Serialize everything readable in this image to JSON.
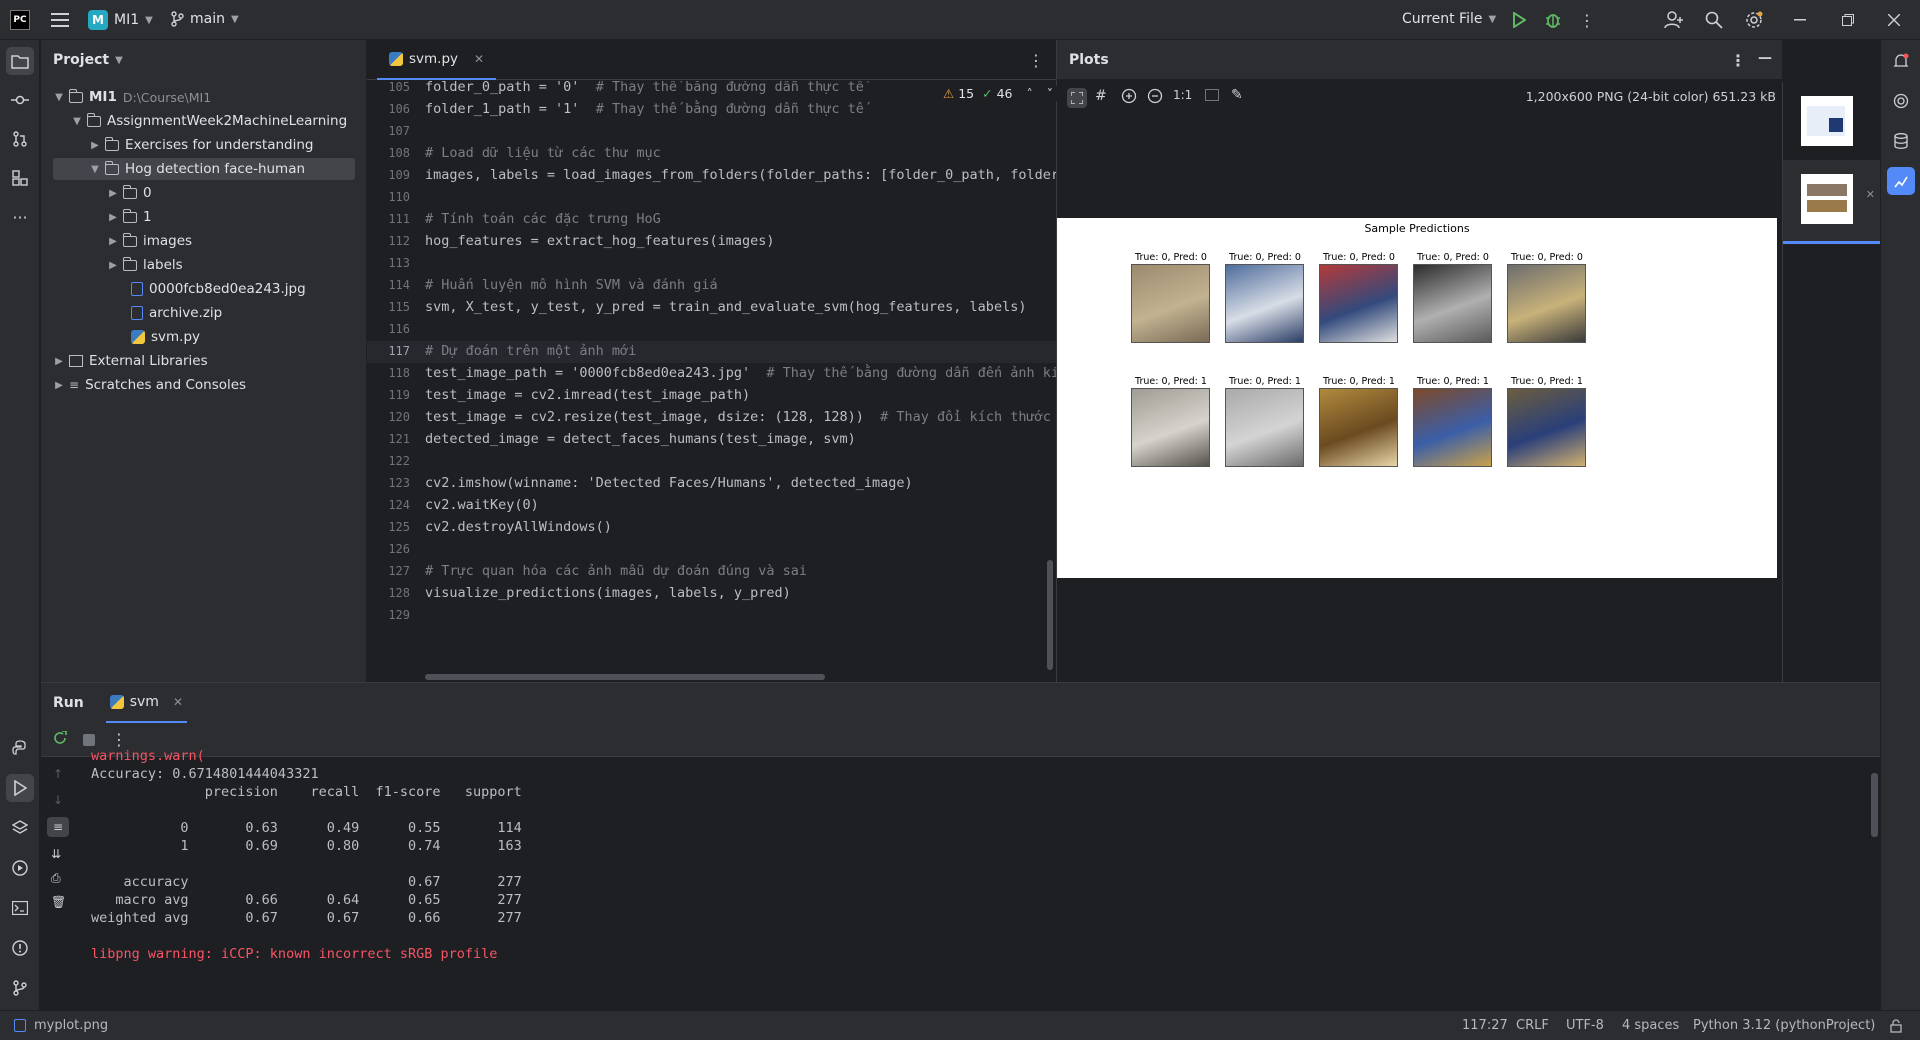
{
  "titlebar": {
    "app_logo": "PC",
    "project_badge": "M",
    "project_name": "MI1",
    "branch": "main",
    "run_config": "Current File"
  },
  "project_panel": {
    "title": "Project",
    "tree": [
      {
        "label": "MI1",
        "hint": "D:\\Course\\MI1",
        "type": "folder",
        "expanded": true
      },
      {
        "label": "AssignmentWeek2MachineLearning",
        "type": "folder",
        "expanded": true
      },
      {
        "label": "Exercises for understanding",
        "type": "folder",
        "expanded": false
      },
      {
        "label": "Hog detection face-human",
        "type": "folder",
        "expanded": true,
        "selected": true
      },
      {
        "label": "0",
        "type": "folder"
      },
      {
        "label": "1",
        "type": "folder"
      },
      {
        "label": "images",
        "type": "folder"
      },
      {
        "label": "labels",
        "type": "folder"
      },
      {
        "label": "0000fcb8ed0ea243.jpg",
        "type": "image"
      },
      {
        "label": "archive.zip",
        "type": "archive"
      },
      {
        "label": "svm.py",
        "type": "python"
      },
      {
        "label": "External Libraries",
        "type": "library"
      },
      {
        "label": "Scratches and Consoles",
        "type": "scratch"
      }
    ]
  },
  "editor": {
    "tab": "svm.py",
    "inspections": {
      "warnings": "15",
      "ok": "46"
    },
    "current_line": "117",
    "lines": [
      {
        "n": "105",
        "text": "folder_0_path = '0'  # Thay thế bằng đường dẫn thực tế"
      },
      {
        "n": "106",
        "text": "folder_1_path = '1'  # Thay thế bằng đường dẫn thực tế"
      },
      {
        "n": "107",
        "text": ""
      },
      {
        "n": "108",
        "text": "# Load dữ liệu từ các thư mục"
      },
      {
        "n": "109",
        "text": "images, labels = load_images_from_folders(folder_paths: [folder_0_path, folder_1_p"
      },
      {
        "n": "110",
        "text": ""
      },
      {
        "n": "111",
        "text": "# Tính toán các đặc trưng HoG"
      },
      {
        "n": "112",
        "text": "hog_features = extract_hog_features(images)"
      },
      {
        "n": "113",
        "text": ""
      },
      {
        "n": "114",
        "text": "# Huấn luyện mô hình SVM và đánh giá"
      },
      {
        "n": "115",
        "text": "svm, X_test, y_test, y_pred = train_and_evaluate_svm(hog_features, labels)"
      },
      {
        "n": "116",
        "text": ""
      },
      {
        "n": "117",
        "text": "# Dự đoán trên một ảnh mới"
      },
      {
        "n": "118",
        "text": "test_image_path = '0000fcb8ed0ea243.jpg'  # Thay thế bằng đường dẫn đến ảnh kiể"
      },
      {
        "n": "119",
        "text": "test_image = cv2.imread(test_image_path)"
      },
      {
        "n": "120",
        "text": "test_image = cv2.resize(test_image, dsize: (128, 128))  # Thay đổi kích thước ản"
      },
      {
        "n": "121",
        "text": "detected_image = detect_faces_humans(test_image, svm)"
      },
      {
        "n": "122",
        "text": ""
      },
      {
        "n": "123",
        "text": "cv2.imshow(winname: 'Detected Faces/Humans', detected_image)"
      },
      {
        "n": "124",
        "text": "cv2.waitKey(0)"
      },
      {
        "n": "125",
        "text": "cv2.destroyAllWindows()"
      },
      {
        "n": "126",
        "text": ""
      },
      {
        "n": "127",
        "text": "# Trực quan hóa các ảnh mẫu dự đoán đúng và sai"
      },
      {
        "n": "128",
        "text": "visualize_predictions(images, labels, y_pred)"
      },
      {
        "n": "129",
        "text": ""
      }
    ]
  },
  "plots": {
    "title": "Plots",
    "zoom_label": "1:1",
    "image_info": "1,200x600 PNG (24-bit color) 651.23 kB",
    "figure_title": "Sample Predictions",
    "row1_titles": [
      "True: 0, Pred: 0",
      "True: 0, Pred: 0",
      "True: 0, Pred: 0",
      "True: 0, Pred: 0",
      "True: 0, Pred: 0"
    ],
    "row2_titles": [
      "True: 0, Pred: 1",
      "True: 0, Pred: 1",
      "True: 0, Pred: 1",
      "True: 0, Pred: 1",
      "True: 0, Pred: 1"
    ]
  },
  "run_panel": {
    "title": "Run",
    "tab": "svm",
    "console": [
      {
        "text": "warnings.warn(",
        "kind": "warn"
      },
      {
        "text": "Accuracy: 0.6714801444043321",
        "kind": "out"
      },
      {
        "text": "              precision    recall  f1-score   support",
        "kind": "out"
      },
      {
        "text": "",
        "kind": "out"
      },
      {
        "text": "           0       0.63      0.49      0.55       114",
        "kind": "out"
      },
      {
        "text": "           1       0.69      0.80      0.74       163",
        "kind": "out"
      },
      {
        "text": "",
        "kind": "out"
      },
      {
        "text": "    accuracy                           0.67       277",
        "kind": "out"
      },
      {
        "text": "   macro avg       0.66      0.64      0.65       277",
        "kind": "out"
      },
      {
        "text": "weighted avg       0.67      0.67      0.66       277",
        "kind": "out"
      },
      {
        "text": "",
        "kind": "out"
      },
      {
        "text": "libpng warning: iCCP: known incorrect sRGB profile",
        "kind": "warn"
      }
    ]
  },
  "statusbar": {
    "file": "myplot.png",
    "position": "117:27",
    "line_sep": "CRLF",
    "encoding": "UTF-8",
    "indent": "4 spaces",
    "interpreter": "Python 3.12 (pythonProject)"
  },
  "colors": {
    "accent": "#548af7",
    "warning": "#f75464",
    "run_green": "#5fb865"
  }
}
